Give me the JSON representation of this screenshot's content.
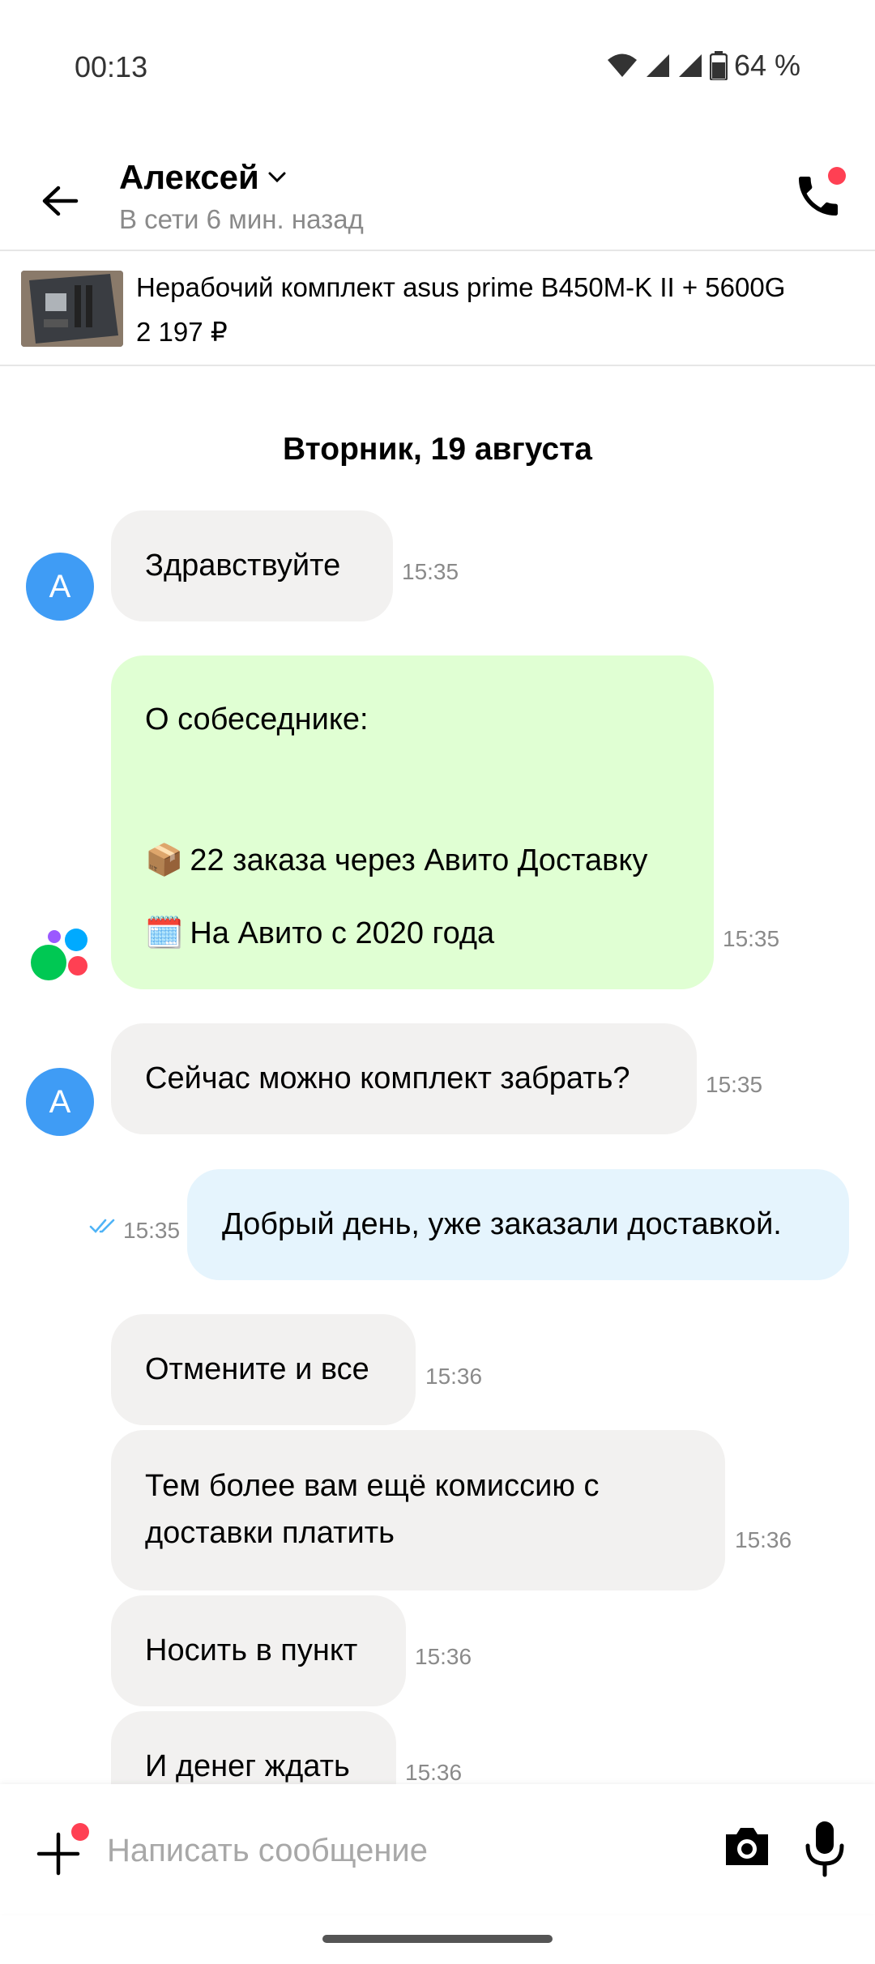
{
  "status_bar": {
    "time": "00:13",
    "battery": "64 %"
  },
  "header": {
    "name": "Алексей",
    "status": "В сети 6 мин. назад"
  },
  "item": {
    "title": "Нерабочий комплект asus prime B450M-K II + 5600G",
    "price": "2 197 ₽"
  },
  "date_separator": "Вторник, 19 августа",
  "messages": [
    {
      "text": "Здравствуйте",
      "time": "15:35"
    },
    {
      "heading": "О собеседнике:",
      "line1_icon": "📦",
      "line1": "22 заказа через Авито Доставку",
      "line2_icon": "🗓️",
      "line2": "На Авито с 2020 года",
      "time": "15:35"
    },
    {
      "text": "Сейчас можно комплект забрать?",
      "time": "15:35"
    },
    {
      "text": "Добрый день, уже заказали доставкой.",
      "time": "15:35"
    },
    {
      "text": "Отмените и все",
      "time": "15:36"
    },
    {
      "text": "Тем более вам ещё комиссию с доставки платить",
      "time": "15:36"
    },
    {
      "text": "Носить в пункт",
      "time": "15:36"
    },
    {
      "text": "И денег ждать",
      "time": "15:36"
    }
  ],
  "avatar_letter": "A",
  "input": {
    "placeholder": "Написать сообщение"
  },
  "colors": {
    "incoming_bubble": "#f2f1f0",
    "system_bubble": "#e0ffd3",
    "outgoing_bubble": "#e5f4fd",
    "avatar": "#3f9cf5",
    "notification_dot": "#ff4053"
  }
}
